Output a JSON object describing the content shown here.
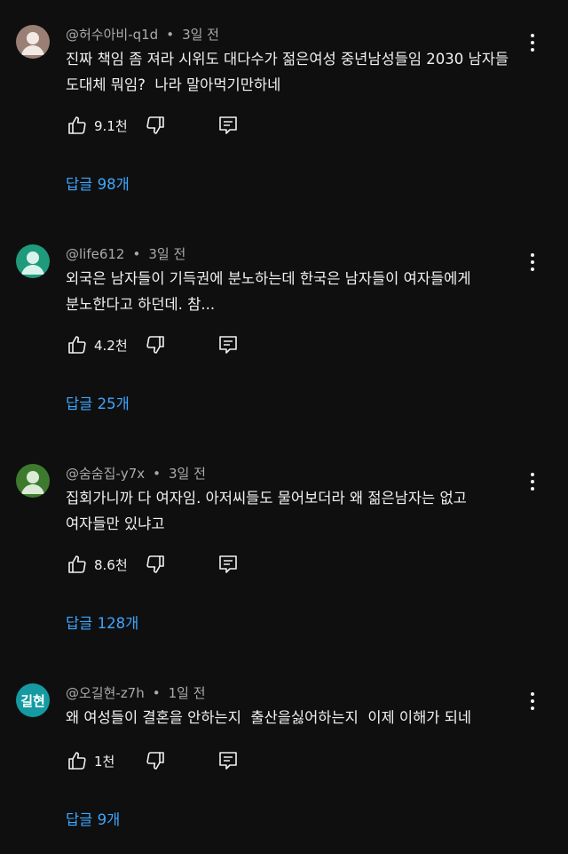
{
  "comments": [
    {
      "author": "@허수아비-q1d",
      "time": "3일 전",
      "text": "진짜 책임 좀 져라 시위도 대다수가 젊은여성 중년남성들임 2030 남자들\n도대체 뭐임?  나라 말아먹기만하네",
      "likes": "9.1천",
      "replies": "답글 98개",
      "avatar_color": "#9a7f74"
    },
    {
      "author": "@life612",
      "time": "3일 전",
      "text": "외국은 남자들이 기득권에 분노하는데 한국은 남자들이 여자들에게\n분노한다고 하던데. 참...",
      "likes": "4.2천",
      "replies": "답글 25개",
      "avatar_color": "#1f9a7a"
    },
    {
      "author": "@숨숨집-y7x",
      "time": "3일 전",
      "text": "집회가니까 다 여자임. 아저씨들도 물어보더라 왜 젊은남자는 없고\n여자들만 있냐고",
      "likes": "8.6천",
      "replies": "답글 128개",
      "avatar_color": "#3e7a2e"
    },
    {
      "author": "@오길현-z7h",
      "time": "1일 전",
      "text": "왜 여성들이 결혼을 안하는지  출산을싫어하는지  이제 이해가 되네",
      "likes": "1천",
      "replies": "답글 9개",
      "avatar_color": "#149aa0",
      "avatar_text": "길현"
    }
  ],
  "icons": {
    "like": "thumbs-up-icon",
    "dislike": "thumbs-down-icon",
    "reply": "reply-icon",
    "more": "more-vertical-icon"
  },
  "colors": {
    "background": "#0f0f0f",
    "text": "#f1f1f1",
    "meta": "#aaaaaa",
    "link": "#3ea6ff"
  }
}
